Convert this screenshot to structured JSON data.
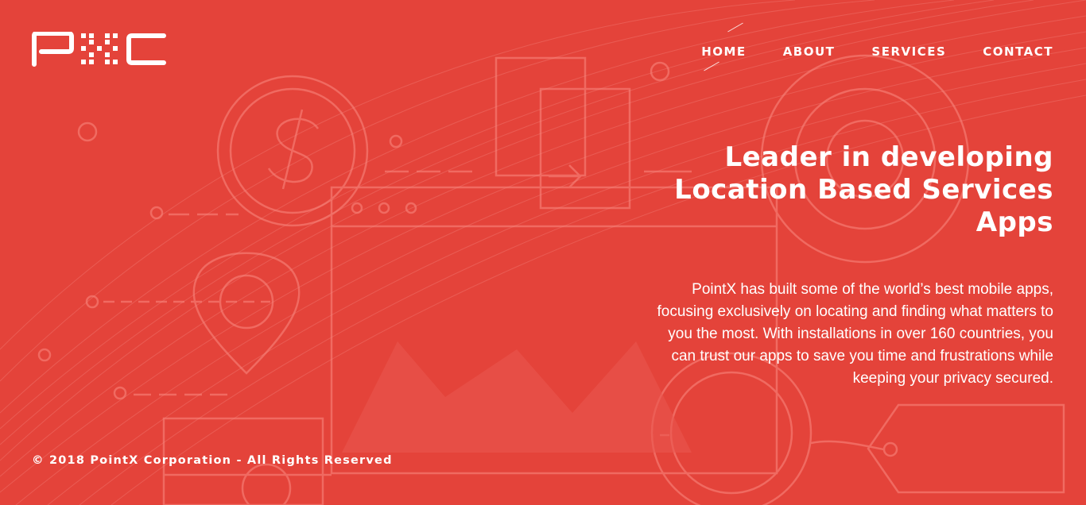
{
  "brand": {
    "logo_text": "PXC"
  },
  "nav": {
    "items": [
      {
        "label": "HOME",
        "active": true
      },
      {
        "label": "ABOUT",
        "active": false
      },
      {
        "label": "SERVICES",
        "active": false
      },
      {
        "label": "CONTACT",
        "active": false
      }
    ]
  },
  "hero": {
    "headline_line1": "Leader in developing",
    "headline_line2": "Location Based Services",
    "headline_line3": "Apps",
    "description": "PointX has built some of the world’s best mobile apps, focusing exclusively on locating and finding what matters to you the most. With installations in over 160 countries, you can trust our apps to save you time and frustrations while keeping your privacy secured."
  },
  "footer": {
    "copyright": "© 2018 PointX Corporation - All Rights Reserved"
  },
  "colors": {
    "background": "#e4433a",
    "foreground": "#ffffff",
    "art_line": "#f07068"
  }
}
